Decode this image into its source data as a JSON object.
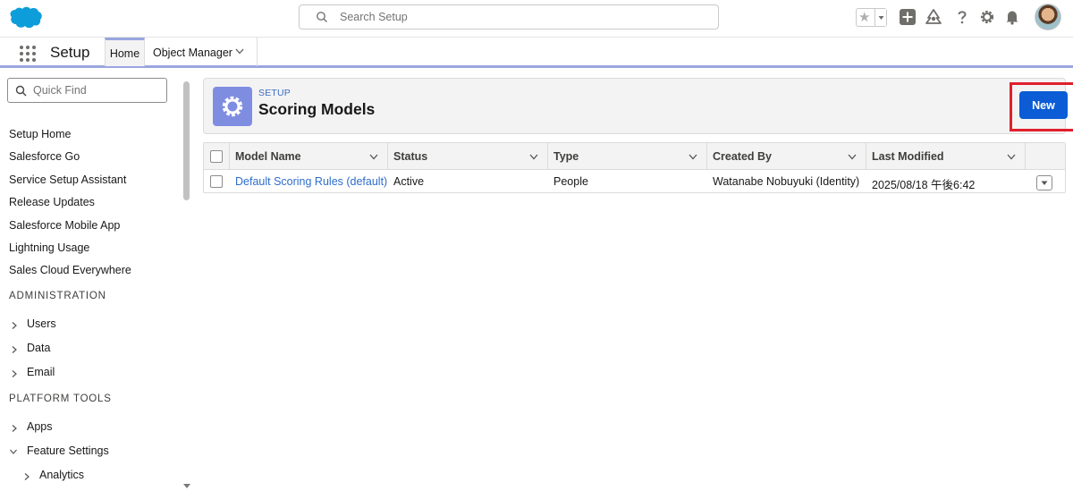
{
  "header": {
    "search_placeholder": "Search Setup",
    "icons": [
      "favorites-star-icon",
      "add-icon",
      "trailhead-icon",
      "help-icon",
      "setup-gear-icon",
      "notifications-bell-icon",
      "avatar"
    ]
  },
  "appnav": {
    "app_name": "Setup",
    "tabs": [
      {
        "label": "Home",
        "active": true
      },
      {
        "label": "Object Manager",
        "active": false
      }
    ]
  },
  "sidebar": {
    "quick_find_placeholder": "Quick Find",
    "links": [
      "Setup Home",
      "Salesforce Go",
      "Service Setup Assistant",
      "Release Updates",
      "Salesforce Mobile App",
      "Lightning Usage",
      "Sales Cloud Everywhere"
    ],
    "sections": [
      {
        "title": "ADMINISTRATION",
        "items": [
          "Users",
          "Data",
          "Email"
        ]
      },
      {
        "title": "PLATFORM TOOLS",
        "items": [
          "Apps",
          "Feature Settings"
        ],
        "sub_items": [
          "Analytics"
        ]
      }
    ]
  },
  "page": {
    "breadcrumb": "SETUP",
    "title": "Scoring Models",
    "new_button": "New"
  },
  "table": {
    "columns": [
      "Model Name",
      "Status",
      "Type",
      "Created By",
      "Last Modified"
    ],
    "rows": [
      {
        "model_name": "Default Scoring Rules (default)",
        "status": "Active",
        "type": "People",
        "created_by": "Watanabe Nobuyuki (Identity)",
        "last_modified": "2025/08/18 午後6:42"
      }
    ]
  },
  "colors": {
    "brand_blue": "#0b5cd5",
    "link_blue": "#2e6dcc",
    "setup_icon_bg": "#7f8de1",
    "highlight_red": "#e01f2a"
  }
}
